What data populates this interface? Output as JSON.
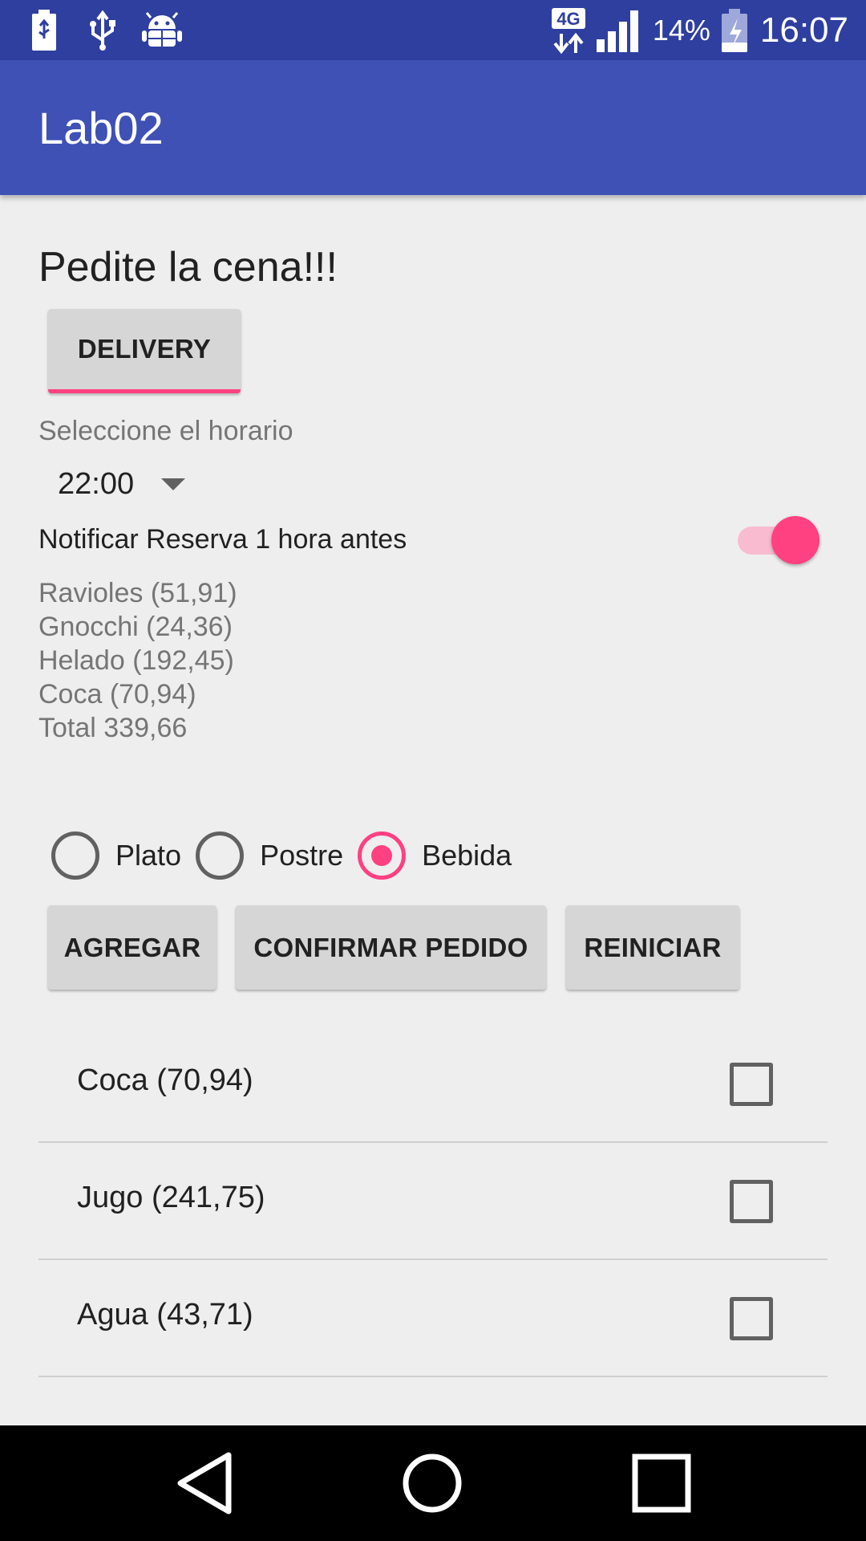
{
  "status_bar": {
    "network_label": "4G",
    "battery_percent": "14%",
    "time": "16:07",
    "icons": [
      "usb-battery-icon",
      "usb-icon",
      "android-debug-icon",
      "network-4g-icon",
      "signal-icon",
      "battery-charging-icon"
    ]
  },
  "app_bar": {
    "title": "Lab02"
  },
  "main": {
    "heading": "Pedite la cena!!!",
    "delivery_button": "DELIVERY",
    "schedule_label": "Seleccione el horario",
    "schedule_value": "22:00",
    "notify_label": "Notificar Reserva 1 hora antes",
    "notify_on": true,
    "order_lines": [
      "Ravioles (51,91)",
      "Gnocchi (24,36)",
      "Helado (192,45)",
      "Coca (70,94)",
      "Total 339,66"
    ],
    "radio_options": [
      {
        "label": "Plato",
        "checked": false
      },
      {
        "label": "Postre",
        "checked": false
      },
      {
        "label": "Bebida",
        "checked": true
      }
    ],
    "buttons": {
      "add": "AGREGAR",
      "confirm": "CONFIRMAR PEDIDO",
      "reset": "REINICIAR"
    },
    "items": [
      {
        "label": "Coca (70,94)",
        "checked": false
      },
      {
        "label": "Jugo (241,75)",
        "checked": false
      },
      {
        "label": "Agua (43,71)",
        "checked": false
      }
    ]
  },
  "colors": {
    "primary": "#3f51b5",
    "primary_dark": "#2f3f9f",
    "accent": "#ff4081"
  },
  "nav_bar": {
    "icons": [
      "back-icon",
      "home-icon",
      "recents-icon"
    ]
  }
}
